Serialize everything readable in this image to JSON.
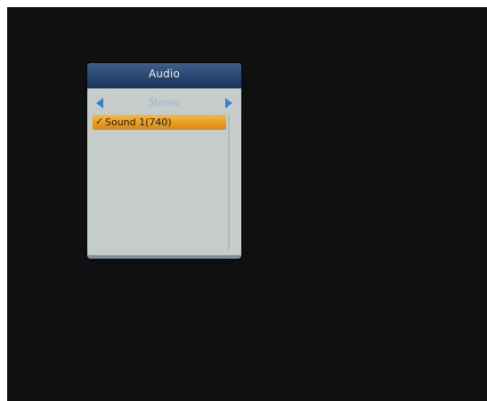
{
  "dialog": {
    "title": "Audio",
    "mode": "Stereo",
    "items": [
      {
        "label": "Sound 1(740)",
        "selected": true,
        "check": "✓"
      }
    ]
  },
  "colors": {
    "screen_bg": "#101010",
    "panel_bg": "#c6ccca",
    "header_bg": "#27466f",
    "highlight": "#e89a1e",
    "arrow": "#2f82d8"
  },
  "icons": {
    "left": "arrow-left-icon",
    "right": "arrow-right-icon",
    "check": "checkmark-icon"
  }
}
